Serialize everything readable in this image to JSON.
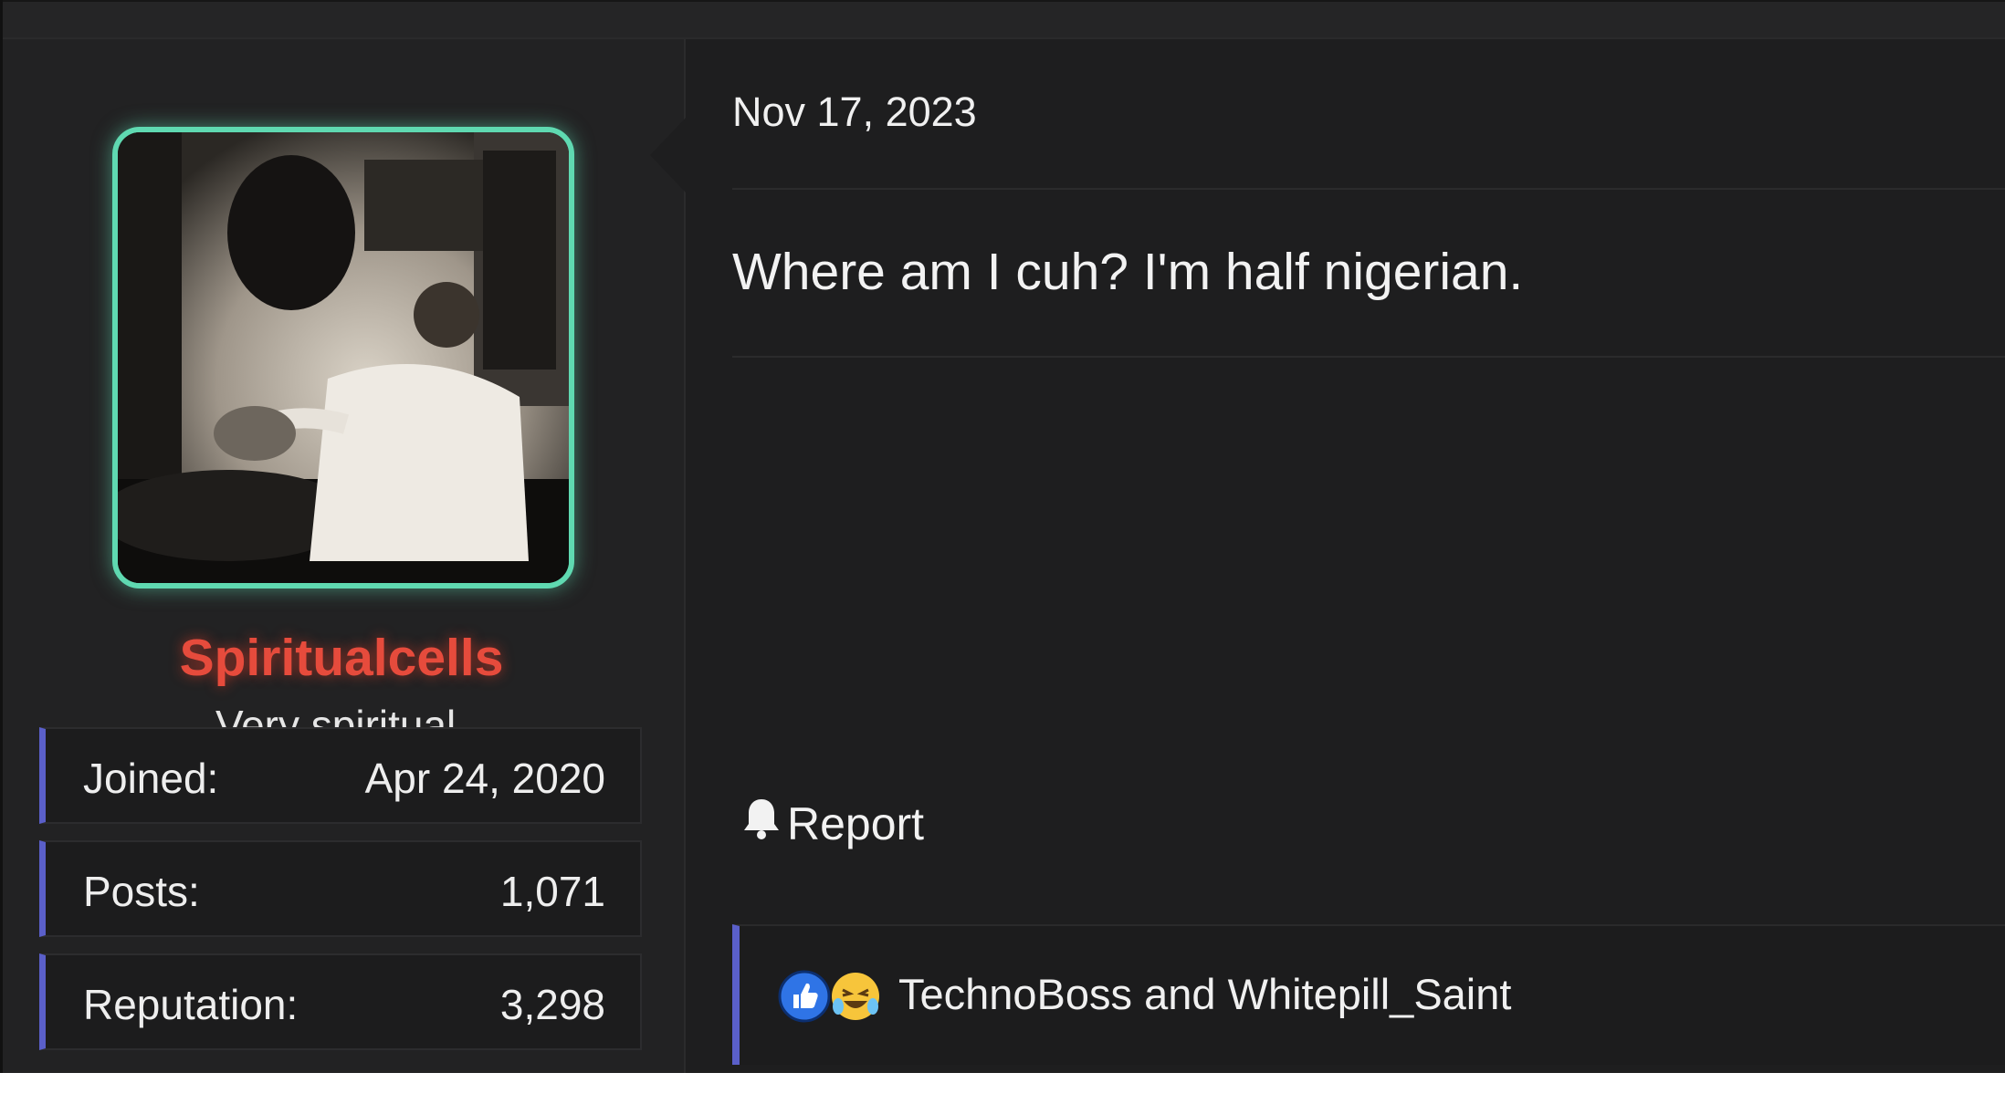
{
  "user": {
    "username": "Spiritualcells",
    "title": "Very spiritual.",
    "avatar_icon": "avatar-photo",
    "accent_color": "#5fd9b1",
    "name_color": "#e64b3c",
    "stats": [
      {
        "label": "Joined:",
        "value": "Apr 24, 2020"
      },
      {
        "label": "Posts:",
        "value": "1,071"
      },
      {
        "label": "Reputation:",
        "value": "3,298"
      }
    ]
  },
  "post": {
    "date": "Nov 17, 2023",
    "message": "Where am I cuh? I'm half nigerian.",
    "report_label": "Report",
    "report_icon": "bell-icon"
  },
  "reactions": {
    "icons": [
      "like-icon",
      "laughing-crying-icon"
    ],
    "names": "TechnoBoss and Whitepill_Saint"
  },
  "colors": {
    "stat_border": "#5a5fc9",
    "background": "#1e1e1f"
  }
}
